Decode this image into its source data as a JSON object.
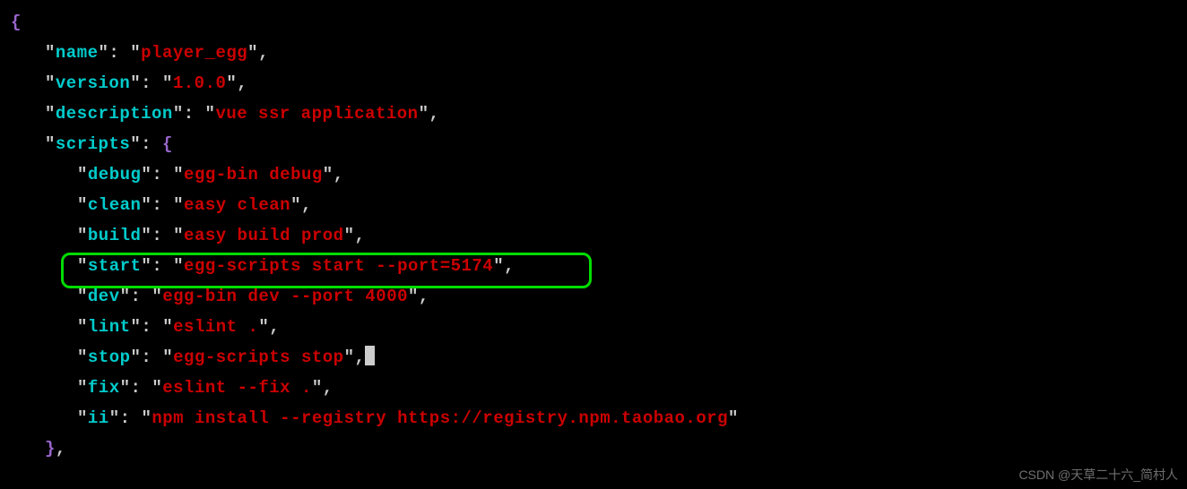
{
  "code": {
    "name_key": "name",
    "name_val": "player_egg",
    "version_key": "version",
    "version_val": "1.0.0",
    "description_key": "description",
    "description_val": "vue ssr application",
    "scripts_key": "scripts",
    "debug_key": "debug",
    "debug_val": "egg-bin debug",
    "clean_key": "clean",
    "clean_val": "easy clean",
    "build_key": "build",
    "build_val": "easy build prod",
    "start_key": "start",
    "start_val": "egg-scripts start --port=5174",
    "dev_key": "dev",
    "dev_val": "egg-bin dev --port 4000",
    "lint_key": "lint",
    "lint_val": "eslint .",
    "stop_key": "stop",
    "stop_val": "egg-scripts stop",
    "fix_key": "fix",
    "fix_val": "eslint --fix .",
    "ii_key": "ii",
    "ii_val": "npm install --registry https://registry.npm.taobao.org"
  },
  "watermark": "CSDN @天草二十六_简村人"
}
